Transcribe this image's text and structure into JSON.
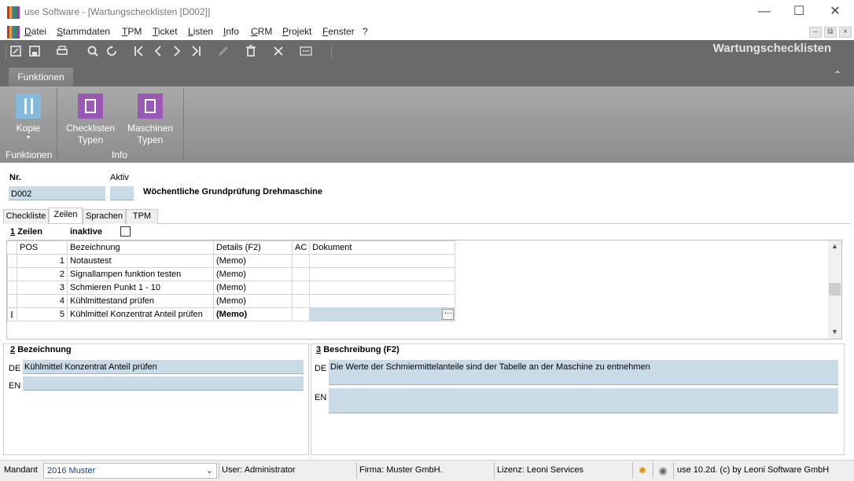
{
  "window": {
    "title": "use Software - [Wartungschecklisten [D002]]",
    "minimize": "—",
    "maximize": "☐",
    "close": "✕"
  },
  "menu": {
    "items": [
      "Datei",
      "Stammdaten",
      "TPM",
      "Ticket",
      "Listen",
      "Info",
      "CRM",
      "Projekt",
      "Fenster",
      "?"
    ],
    "mdi_minimize": "–",
    "mdi_restore": "⧉",
    "mdi_close": "×"
  },
  "toolbar": {
    "caption": "Wartungschecklisten",
    "buttons": [
      "new-icon",
      "save-icon",
      "print-icon",
      "search-icon",
      "refresh-icon",
      "first-record-icon",
      "previous-record-icon",
      "next-record-icon",
      "last-record-icon",
      "edit-icon",
      "delete-icon",
      "cancel-icon",
      "more-icon"
    ]
  },
  "ribbon": {
    "tab": "Funktionen",
    "collapse": "⌃",
    "buttons": {
      "kopie": "Kopie",
      "kopie_dropdown": "▾",
      "checklisten_typen_line1": "Checklisten",
      "checklisten_typen_line2": "Typen",
      "maschinen_typen_line1": "Maschinen",
      "maschinen_typen_line2": "Typen"
    },
    "groups": {
      "funktionen": "Funktionen",
      "info": "Info"
    }
  },
  "header": {
    "nr_label": "Nr.",
    "nr_value": "D002",
    "aktiv_label": "Aktiv",
    "aktiv_value": "",
    "description": "Wöchentliche Grundprüfung Drehmaschine"
  },
  "tabs": [
    "Checkliste",
    "Zeilen",
    "Sprachen",
    "TPM"
  ],
  "active_tab": "Zeilen",
  "zeilen": {
    "section_number": "1",
    "section_title": "Zeilen",
    "inactive_label": "inaktive",
    "inactive_checked": false,
    "columns": [
      "POS",
      "Bezeichnung",
      "Details (F2)",
      "AC",
      "Dokument"
    ],
    "rows": [
      {
        "pos": "1",
        "bezeichnung": "Notaustest",
        "details": "(Memo)",
        "ac": "",
        "dokument": ""
      },
      {
        "pos": "2",
        "bezeichnung": "Signallampen funktion testen",
        "details": "(Memo)",
        "ac": "",
        "dokument": ""
      },
      {
        "pos": "3",
        "bezeichnung": "Schmieren Punkt 1 - 10",
        "details": "(Memo)",
        "ac": "",
        "dokument": ""
      },
      {
        "pos": "4",
        "bezeichnung": "Kühlmittestand prüfen",
        "details": "(Memo)",
        "ac": "",
        "dokument": ""
      },
      {
        "pos": "5",
        "bezeichnung": "Kühlmittel Konzentrat Anteil prüfen",
        "details": "(Memo)",
        "ac": "",
        "dokument": ""
      }
    ],
    "current_row_marker": "I",
    "ellipsis": "···"
  },
  "bezeichnung": {
    "section_number": "2",
    "section_title": "Bezeichnung",
    "de_label": "DE",
    "de_value": "Kühlmittel Konzentrat Anteil prüfen",
    "en_label": "EN",
    "en_value": ""
  },
  "beschreibung": {
    "section_number": "3",
    "section_title": "Beschreibung (F2)",
    "de_label": "DE",
    "de_value": "Die Werte der Schmiermittelanteile sind der Tabelle an der Maschine zu entnehmen",
    "en_label": "EN",
    "en_value": ""
  },
  "statusbar": {
    "mandant_label": "Mandant",
    "mandant_value": "2016 Muster",
    "user": "User: Administrator",
    "firma": "Firma: Muster GmbH.",
    "lizenz": "Lizenz: Leoni Services",
    "version": "use 10.2d. (c) by Leoni Software GmbH"
  }
}
